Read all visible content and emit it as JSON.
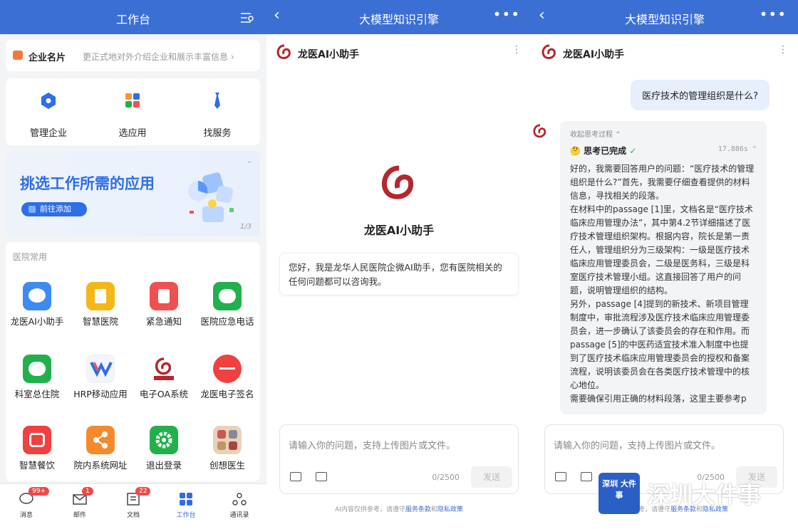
{
  "panel1": {
    "title": "工作台",
    "name_card": {
      "label": "企业名片",
      "desc": "更正式地对外介绍企业和展示丰富信息",
      "icon": "id-card-icon"
    },
    "quick": [
      {
        "label": "管理企业",
        "icon": "hexagon-icon",
        "color": "#2e6ee6"
      },
      {
        "label": "选应用",
        "icon": "grid-icon",
        "color": "#f29a30"
      },
      {
        "label": "找服务",
        "icon": "tie-icon",
        "color": "#2e6ee6"
      }
    ],
    "banner": {
      "title": "挑选工作所需的应用",
      "button": "前往添加",
      "page": "1/3"
    },
    "apps_header": "医院常用",
    "apps": [
      {
        "label": "龙医AI小助手",
        "color": "#3d8bf0"
      },
      {
        "label": "智慧医院",
        "color": "#f5b617"
      },
      {
        "label": "紧急通知",
        "color": "#f05050"
      },
      {
        "label": "医院应急电话",
        "color": "#21b14c"
      },
      {
        "label": "科室总住院",
        "color": "#21b14c"
      },
      {
        "label": "HRP移动应用",
        "color": "#e9e9ff"
      },
      {
        "label": "电子OA系统",
        "color": "#ffffff"
      },
      {
        "label": "龙医电子签名",
        "color": "#f04040"
      },
      {
        "label": "智慧餐饮",
        "color": "#f04040"
      },
      {
        "label": "院内系统网址",
        "color": "#f58a2a"
      },
      {
        "label": "退出登录",
        "color": "#21b14c"
      },
      {
        "label": "创想医生",
        "color": "#e8d2b8"
      }
    ],
    "tabs": [
      {
        "label": "消息",
        "badge": "99+",
        "icon": "chat-icon"
      },
      {
        "label": "邮件",
        "badge": "1",
        "icon": "mail-icon"
      },
      {
        "label": "文档",
        "badge": "22",
        "icon": "doc-icon"
      },
      {
        "label": "工作台",
        "badge": "",
        "icon": "workbench-icon",
        "active": true
      },
      {
        "label": "通讯录",
        "badge": "",
        "icon": "contacts-icon"
      }
    ]
  },
  "panel2": {
    "title": "大模型知识引擎",
    "bot_name": "龙医AI小助手",
    "center_name": "龙医AI小助手",
    "greeting": "您好，我是龙华人民医院企微AI助手，您有医院相关的任何问题都可以咨询我。",
    "placeholder": "请输入你的问题，支持上传图片或文件。",
    "counter": "0/2500",
    "send": "发送",
    "disclaimer_pre": "AI内容仅供参考，请遵守",
    "terms": "服务条款",
    "and": "和",
    "privacy": "隐私政策"
  },
  "panel3": {
    "title": "大模型知识引擎",
    "bot_name": "龙医AI小助手",
    "question": "医疗技术的管理组织是什么?",
    "collapse": "收起思考过程",
    "done": "思考已完成",
    "time": "17.886s",
    "paragraphs": [
      "好的，我需要回答用户的问题：“医疗技术的管理组织是什么?”首先，我需要仔细查看提供的材料信息，寻找相关的段落。",
      "在材料中的passage [1]里，文档名是“医疗技术临床应用管理办法”，其中第4.2节详细描述了医疗技术管理组织架构。根据内容，院长是第一责任人，管理组织分为三级架构：一级是医疗技术临床应用管理委员会，二级是医务科，三级是科室医疗技术管理小组。这直接回答了用户的问题，说明管理组织的结构。",
      "另外，passage [4]提到的新技术、新项目管理制度中，审批流程涉及医疗技术临床应用管理委员会，进一步确认了该委员会的存在和作用。而passage [5]的中医药适宜技术准入制度中也提到了医疗技术临床应用管理委员会的授权和备案流程，说明该委员会在各类医疗技术管理中的核心地位。",
      "需要确保引用正确的材料段落，这里主要参考p"
    ],
    "placeholder": "请输入你的问题，支持上传图片或文件。",
    "counter": "0/2500",
    "send": "发送",
    "disclaimer_pre": "考，请遵守",
    "terms": "服务条款",
    "and": "和",
    "privacy": "隐私政策",
    "watermark_badge": "深圳 大件事",
    "watermark_text": "深圳大件事"
  },
  "colors": {
    "brand_blue": "#3b6fd4",
    "logo_red": "#b5262e"
  }
}
